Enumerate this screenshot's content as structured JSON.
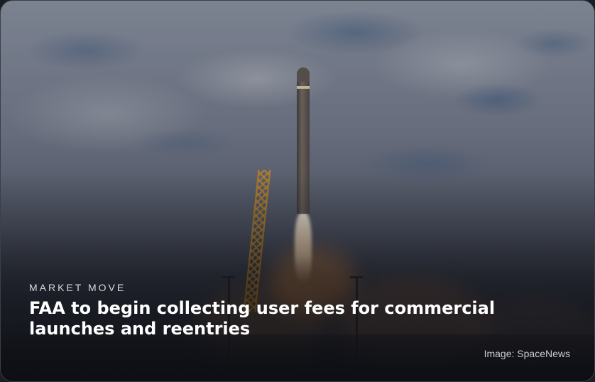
{
  "card": {
    "kicker": "MARKET MOVE",
    "headline": "FAA to begin collecting user fees for commercial launches and reentries",
    "image_credit": "Image: SpaceNews"
  },
  "colors": {
    "headline": "#ffffff",
    "kicker": "#d8dae0",
    "credit": "#c9ccd3"
  }
}
